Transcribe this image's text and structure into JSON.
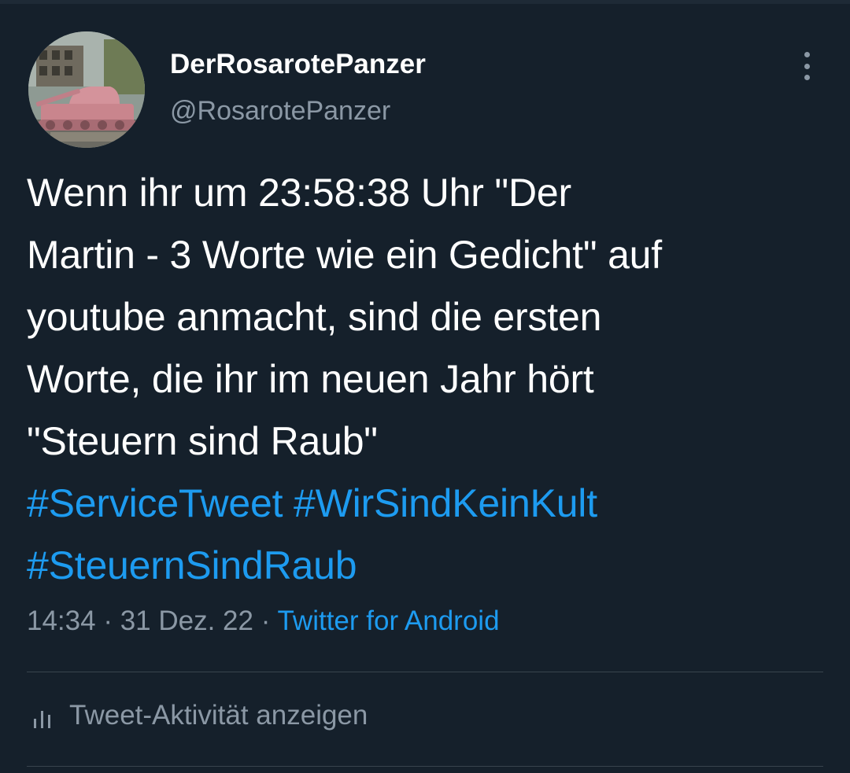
{
  "author": {
    "display_name": "DerRosarotePanzer",
    "handle": "@RosarotePanzer",
    "avatar_icon": "pink-tank-avatar"
  },
  "tweet": {
    "lines": [
      "Wenn ihr um 23:58:38 Uhr \"Der",
      "Martin - 3 Worte wie ein Gedicht\" auf",
      "youtube anmacht, sind die ersten",
      "Worte, die ihr im neuen Jahr hört",
      "\"Steuern sind Raub\""
    ],
    "hashtags_line1": [
      "#ServiceTweet",
      "#WirSindKeinKult"
    ],
    "hashtags_line2": [
      "#SteuernSindRaub"
    ]
  },
  "meta": {
    "time": "14:34",
    "separator": " · ",
    "date": "31 Dez. 22",
    "source": "Twitter for Android"
  },
  "activity": {
    "label": "Tweet-Aktivität anzeigen",
    "icon": "bar-chart-icon"
  },
  "more_icon": "more-vertical-icon",
  "colors": {
    "background": "#15202b",
    "text": "#ffffff",
    "muted": "#8b98a5",
    "link": "#1d9bf0",
    "divider": "#38444d"
  }
}
